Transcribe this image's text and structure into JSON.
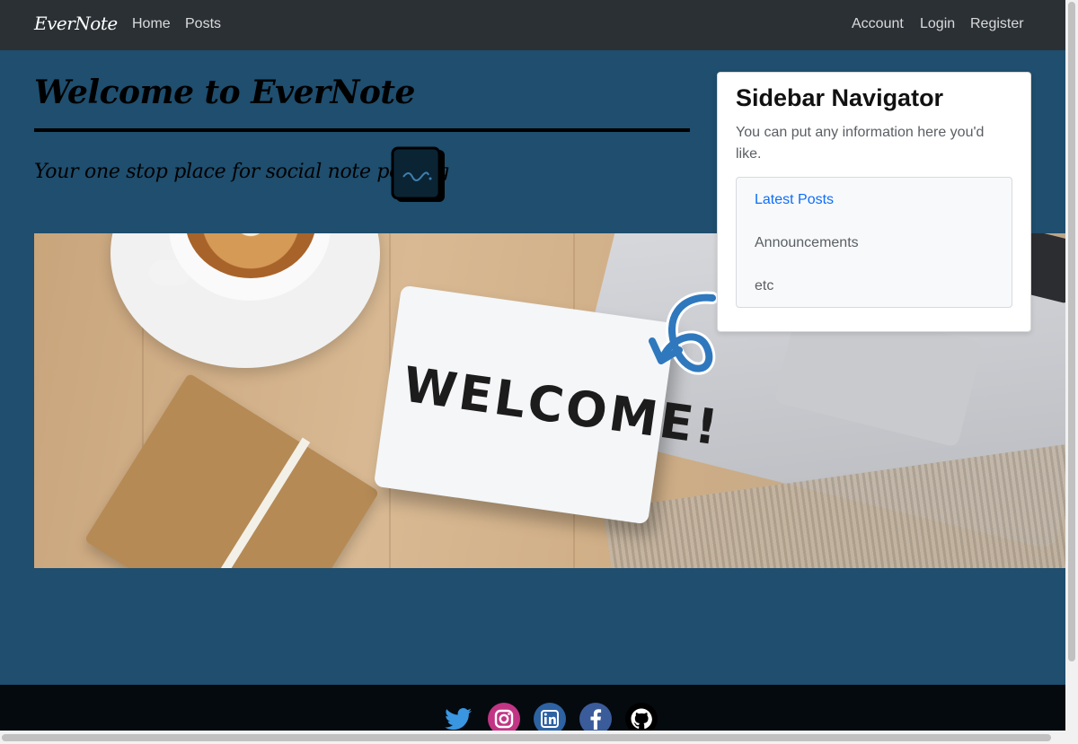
{
  "navbar": {
    "brand": "EverNote",
    "left_links": [
      "Home",
      "Posts"
    ],
    "right_links": [
      "Account",
      "Login",
      "Register"
    ]
  },
  "hero": {
    "title": "Welcome to EverNote",
    "tagline": "Your one stop place for social note posting",
    "tagline_icon": "note-pad-icon"
  },
  "banner": {
    "sign_text": "WELCOME!",
    "icon": "curved-arrow-icon"
  },
  "sidebar": {
    "title": "Sidebar Navigator",
    "text": "You can put any information here you'd like.",
    "items": [
      {
        "label": "Latest Posts",
        "active": true
      },
      {
        "label": "Announcements",
        "active": false
      },
      {
        "label": "etc",
        "active": false
      }
    ]
  },
  "footer": {
    "socials": [
      "twitter-icon",
      "instagram-icon",
      "linkedin-icon",
      "facebook-icon",
      "github-icon"
    ]
  },
  "colors": {
    "page_bg": "#1f4e6e",
    "navbar_bg": "#2b3035",
    "footer_bg": "#050a0f",
    "link_active": "#0d6efd"
  }
}
